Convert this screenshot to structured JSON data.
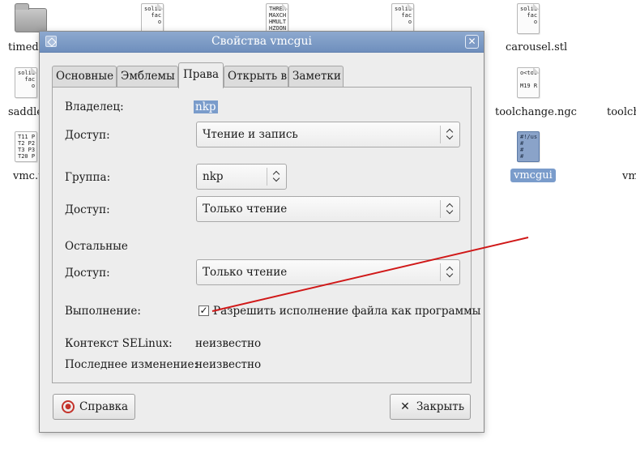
{
  "desktop": {
    "icons": [
      {
        "id": "timedel",
        "label": "timede"
      },
      {
        "id": "solid1",
        "label": "",
        "preview": "solid\n  fac\n    o"
      },
      {
        "id": "thread",
        "label": "",
        "preview": "THREA\nMAXCH\nHMULT\nHZOON"
      },
      {
        "id": "solid2",
        "label": "",
        "preview": "solid\n  fac\n    o"
      },
      {
        "id": "carousel",
        "label": "carousel.stl",
        "preview": "solid\n  fac\n    o"
      },
      {
        "id": "saddle",
        "label": "saddle",
        "preview": "solid\n  fac\n    o"
      },
      {
        "id": "toolchange",
        "label": "toolchange.ngc",
        "preview": "o<too\n\nM19 R"
      },
      {
        "id": "toolch2",
        "label": "toolch"
      },
      {
        "id": "vmc",
        "label": "vmc.t",
        "preview": "T11 P\nT2 P2\nT3 P3\nT20 P"
      },
      {
        "id": "vmcgui",
        "label": "vmcgui",
        "preview": "#!/us\n#\n#\n#"
      },
      {
        "id": "vm",
        "label": "vm"
      }
    ]
  },
  "dialog": {
    "title": "Свойства vmcgui",
    "tabs": [
      {
        "label": "Основные"
      },
      {
        "label": "Эмблемы"
      },
      {
        "label": "Права"
      },
      {
        "label": "Открыть в"
      },
      {
        "label": "Заметки"
      }
    ],
    "owner_label": "Владелец:",
    "owner_value": "nkp",
    "owner_access_label": "Доступ:",
    "owner_access_value": "Чтение и запись",
    "group_label": "Группа:",
    "group_value": "nkp",
    "group_access_label": "Доступ:",
    "group_access_value": "Только чтение",
    "others_label": "Остальные",
    "others_access_label": "Доступ:",
    "others_access_value": "Только чтение",
    "exec_label": "Выполнение:",
    "exec_checkbox_label": "Разрешить исполнение файла как программы",
    "exec_checked": true,
    "selinux_label": "Контекст SELinux:",
    "selinux_value": "неизвестно",
    "modified_label": "Последнее изменение:",
    "modified_value": "неизвестно",
    "help_button": "Справка",
    "close_button": "Закрыть"
  },
  "annotation": {
    "color": "#d01818"
  }
}
